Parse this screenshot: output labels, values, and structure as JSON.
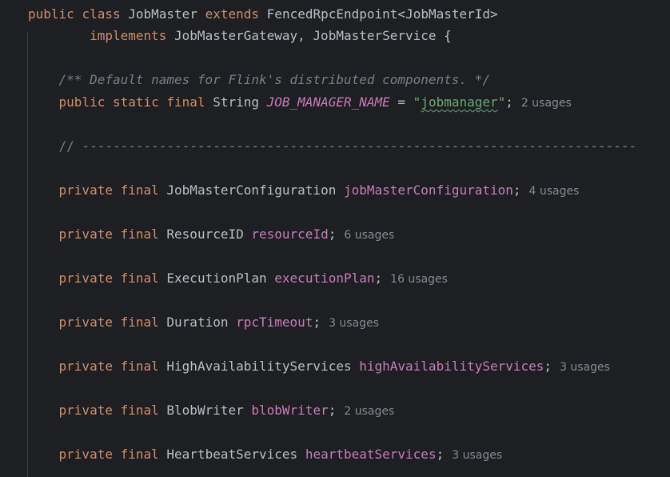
{
  "editor": {
    "class_decl": {
      "kw_public": "public",
      "kw_class": "class",
      "class_name": "JobMaster",
      "kw_extends": "extends",
      "super_class": "FencedRpcEndpoint<JobMasterId>"
    },
    "implements_decl": {
      "kw_implements": "implements",
      "interfaces": "JobMasterGateway, JobMasterService {"
    },
    "doc_comment": "/** Default names for Flink's distributed components. */",
    "job_manager_name": {
      "modifiers": "public static final",
      "type": "String",
      "name": "JOB_MANAGER_NAME",
      "assign": " = ",
      "value_quote_open": "\"",
      "value": "jobmanager",
      "value_quote_close": "\"",
      "semicolon": ";",
      "usages": "2 usages"
    },
    "separator_comment": "// ------------------------------------------------------------------------",
    "fields": [
      {
        "modifiers": "private final",
        "type": "JobMasterConfiguration",
        "name": "jobMasterConfiguration",
        "semicolon": ";",
        "usages": "4 usages"
      },
      {
        "modifiers": "private final",
        "type": "ResourceID",
        "name": "resourceId",
        "semicolon": ";",
        "usages": "6 usages"
      },
      {
        "modifiers": "private final",
        "type": "ExecutionPlan",
        "name": "executionPlan",
        "semicolon": ";",
        "usages": "16 usages"
      },
      {
        "modifiers": "private final",
        "type": "Duration",
        "name": "rpcTimeout",
        "semicolon": ";",
        "usages": "3 usages"
      },
      {
        "modifiers": "private final",
        "type": "HighAvailabilityServices",
        "name": "highAvailabilityServices",
        "semicolon": ";",
        "usages": "3 usages"
      },
      {
        "modifiers": "private final",
        "type": "BlobWriter",
        "name": "blobWriter",
        "semicolon": ";",
        "usages": "2 usages"
      },
      {
        "modifiers": "private final",
        "type": "HeartbeatServices",
        "name": "heartbeatServices",
        "semicolon": ";",
        "usages": "3 usages"
      }
    ]
  },
  "colors": {
    "background": "#1e1f22",
    "keyword": "#cf8e6d",
    "field": "#c77dbb",
    "string": "#6aab73",
    "comment": "#7a7e85",
    "text": "#bcbec4",
    "hint": "#868a91"
  }
}
